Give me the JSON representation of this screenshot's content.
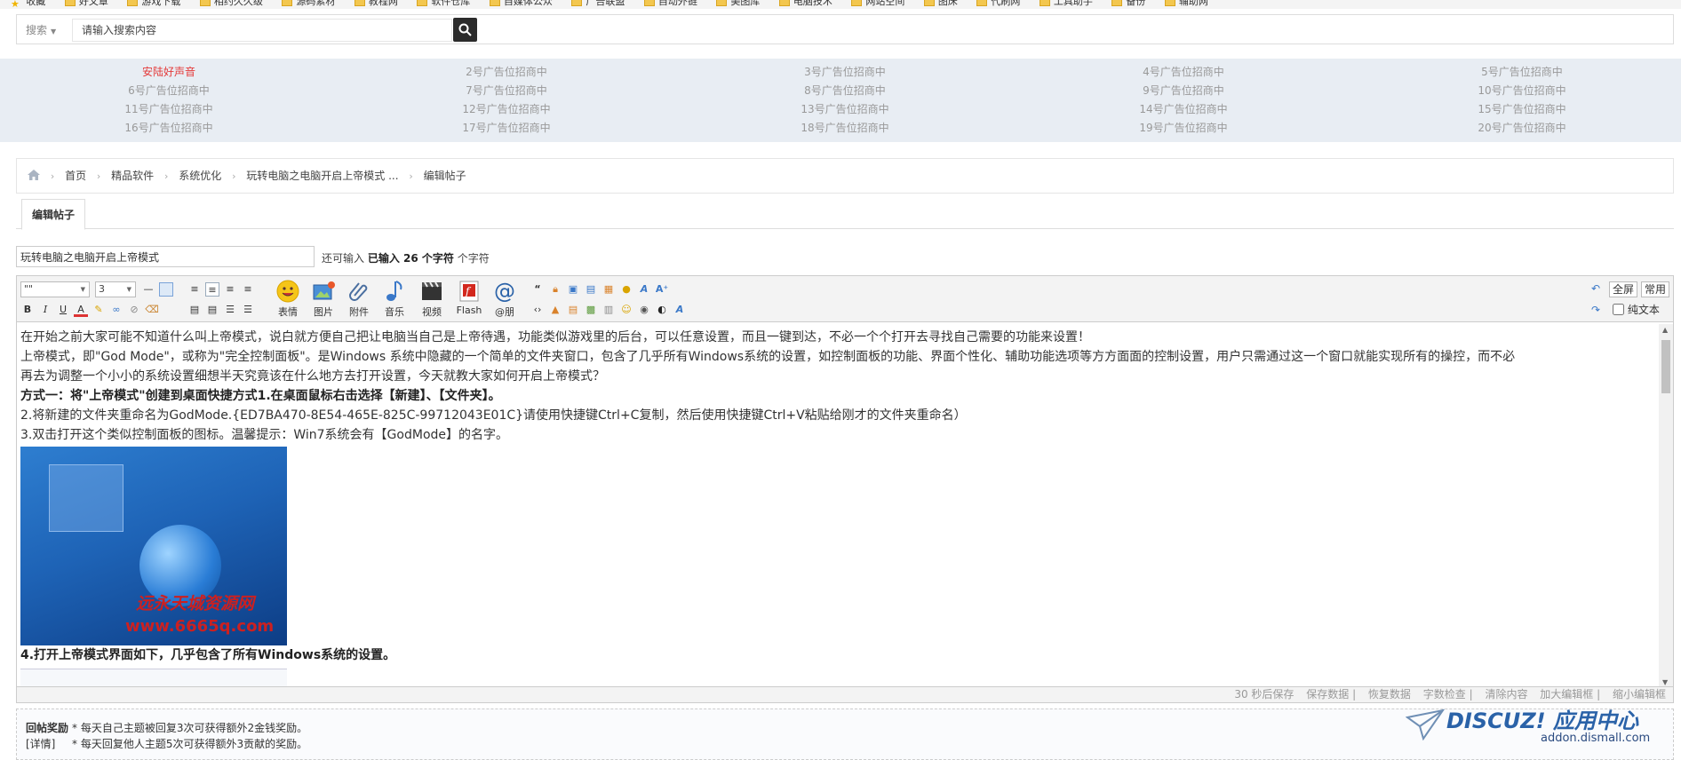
{
  "bookmarks": {
    "items": [
      "收藏",
      "好文章",
      "游戏下载",
      "相约久久级",
      "源码素材",
      "教程网",
      "软件仓库",
      "自媒体公众",
      "广告联盟",
      "自动外链",
      "美图库",
      "电脑技术",
      "网站空间",
      "图床",
      "代刷网",
      "工具助手",
      "备份",
      "辅助网"
    ]
  },
  "search": {
    "type_label": "搜索",
    "placeholder": "请输入搜索内容"
  },
  "ads": {
    "cells": [
      "安陆好声音",
      "2号广告位招商中",
      "3号广告位招商中",
      "4号广告位招商中",
      "5号广告位招商中",
      "6号广告位招商中",
      "7号广告位招商中",
      "8号广告位招商中",
      "9号广告位招商中",
      "10号广告位招商中",
      "11号广告位招商中",
      "12号广告位招商中",
      "13号广告位招商中",
      "14号广告位招商中",
      "15号广告位招商中",
      "16号广告位招商中",
      "17号广告位招商中",
      "18号广告位招商中",
      "19号广告位招商中",
      "20号广告位招商中"
    ]
  },
  "breadcrumb": {
    "items": [
      "首页",
      "精品软件",
      "系统优化",
      "玩转电脑之电脑开启上帝模式 ...",
      "编辑帖子"
    ]
  },
  "tab": {
    "label": "编辑帖子"
  },
  "title_field": {
    "value": "玩转电脑之电脑开启上帝模式",
    "hint_prefix": "还可输入",
    "hint_count": "已输入 26 个字符",
    "hint_suffix": "个字符"
  },
  "toolbar": {
    "font_value": "\"\"",
    "size_value": "3",
    "emoji": "表情",
    "image": "图片",
    "attachment": "附件",
    "music": "音乐",
    "video": "视频",
    "flash": "Flash",
    "at": "@朋",
    "fullscreen": "全屏",
    "common": "常用",
    "plain_text": "纯文本"
  },
  "content": {
    "p1": "在开始之前大家可能不知道什么叫上帝模式，说白就方便自己把让电脑当自己是上帝待遇，功能类似游戏里的后台，可以任意设置，而且一键到达，不必一个个打开去寻找自己需要的功能来设置！",
    "p2": "上帝模式，即\"God Mode\"，或称为\"完全控制面板\"。是Windows 系统中隐藏的一个简单的文件夹窗口，包含了几乎所有Windows系统的设置，如控制面板的功能、界面个性化、辅助功能选项等方方面面的控制设置，用户只需通过这一个窗口就能实现所有的操控，而不必",
    "p3": "再去为调整一个小小的系统设置细想半天究竟该在什么地方去打开设置，今天就教大家如何开启上帝模式？",
    "p4": "方式一：将\"上帝模式\"创建到桌面快捷方式1.在桌面鼠标右击选择【新建】、【文件夹】。",
    "p5": "2.将新建的文件夹重命名为GodMode.{ED7BA470-8E54-465E-825C-99712043E01C}请使用快捷键Ctrl+C复制，然后使用快捷键Ctrl+V粘贴给刚才的文件夹重命名）",
    "p6": "3.双击打开这个类似控制面板的图标。温馨提示：Win7系统会有【GodMode】的名字。",
    "img_wm1": "远永天城资源网",
    "img_wm2": "www.6665q.com",
    "p7": "4.打开上帝模式界面如下，几乎包含了所有Windows系统的设置。"
  },
  "statusbar": {
    "autosave": "30 秒后保存",
    "save": "保存数据",
    "restore": "恢复数据",
    "wordcount": "字数检查",
    "clear": "清除内容",
    "enlarge": "加大编辑框",
    "shrink": "缩小编辑框"
  },
  "reward": {
    "label": "回帖奖励",
    "detail_label": "[详情]",
    "line1": "* 每天自己主题被回复3次可获得额外2金钱奖励。",
    "line2": "* 每天回复他人主题5次可获得额外3贡献的奖励。"
  },
  "brand": {
    "logo": "DISCUZ! 应用中心",
    "url": "addon.dismall.com"
  }
}
